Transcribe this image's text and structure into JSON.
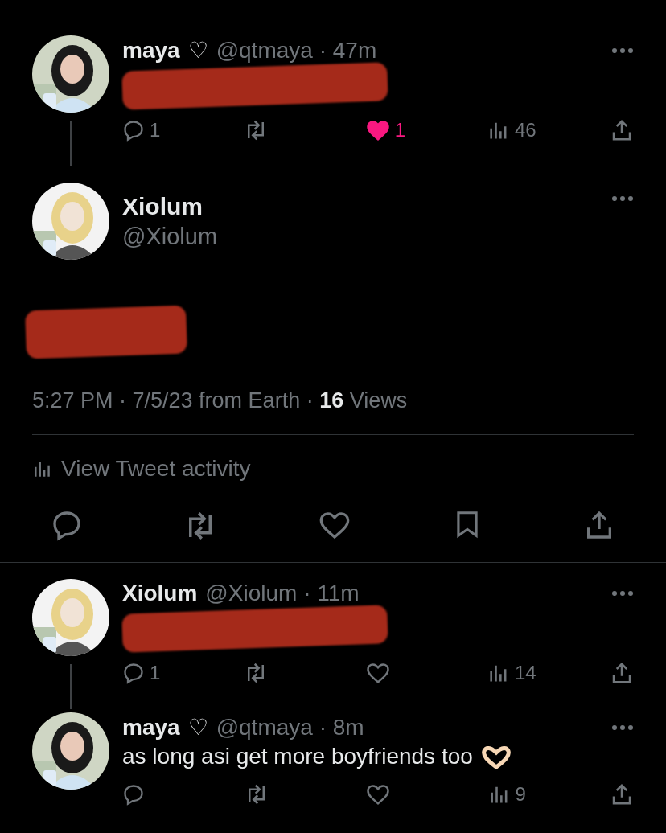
{
  "tweets": [
    {
      "kind": "reply",
      "name": "maya",
      "badge": "♡",
      "meta": "@qtmaya · 47m",
      "redacted": true,
      "thread_line": true,
      "replies": "1",
      "likes": "1",
      "liked": true,
      "views": "46"
    },
    {
      "kind": "focused",
      "name": "Xiolum",
      "handle": "@Xiolum",
      "redacted": true,
      "timestamp": "5:27 PM · 7/5/23 from Earth · **16** Views",
      "activity": "View Tweet activity"
    },
    {
      "kind": "reply",
      "name": "Xiolum",
      "meta": "@Xiolum · 11m",
      "redacted": true,
      "thread_line": true,
      "replies": "1",
      "liked": false,
      "views": "14"
    },
    {
      "kind": "reply",
      "name": "maya",
      "badge": "♡",
      "meta": "@qtmaya · 8m",
      "text": "as long asi get more boyfriends too",
      "emoji": true,
      "thread_line": false,
      "liked": false,
      "views": "9"
    }
  ]
}
